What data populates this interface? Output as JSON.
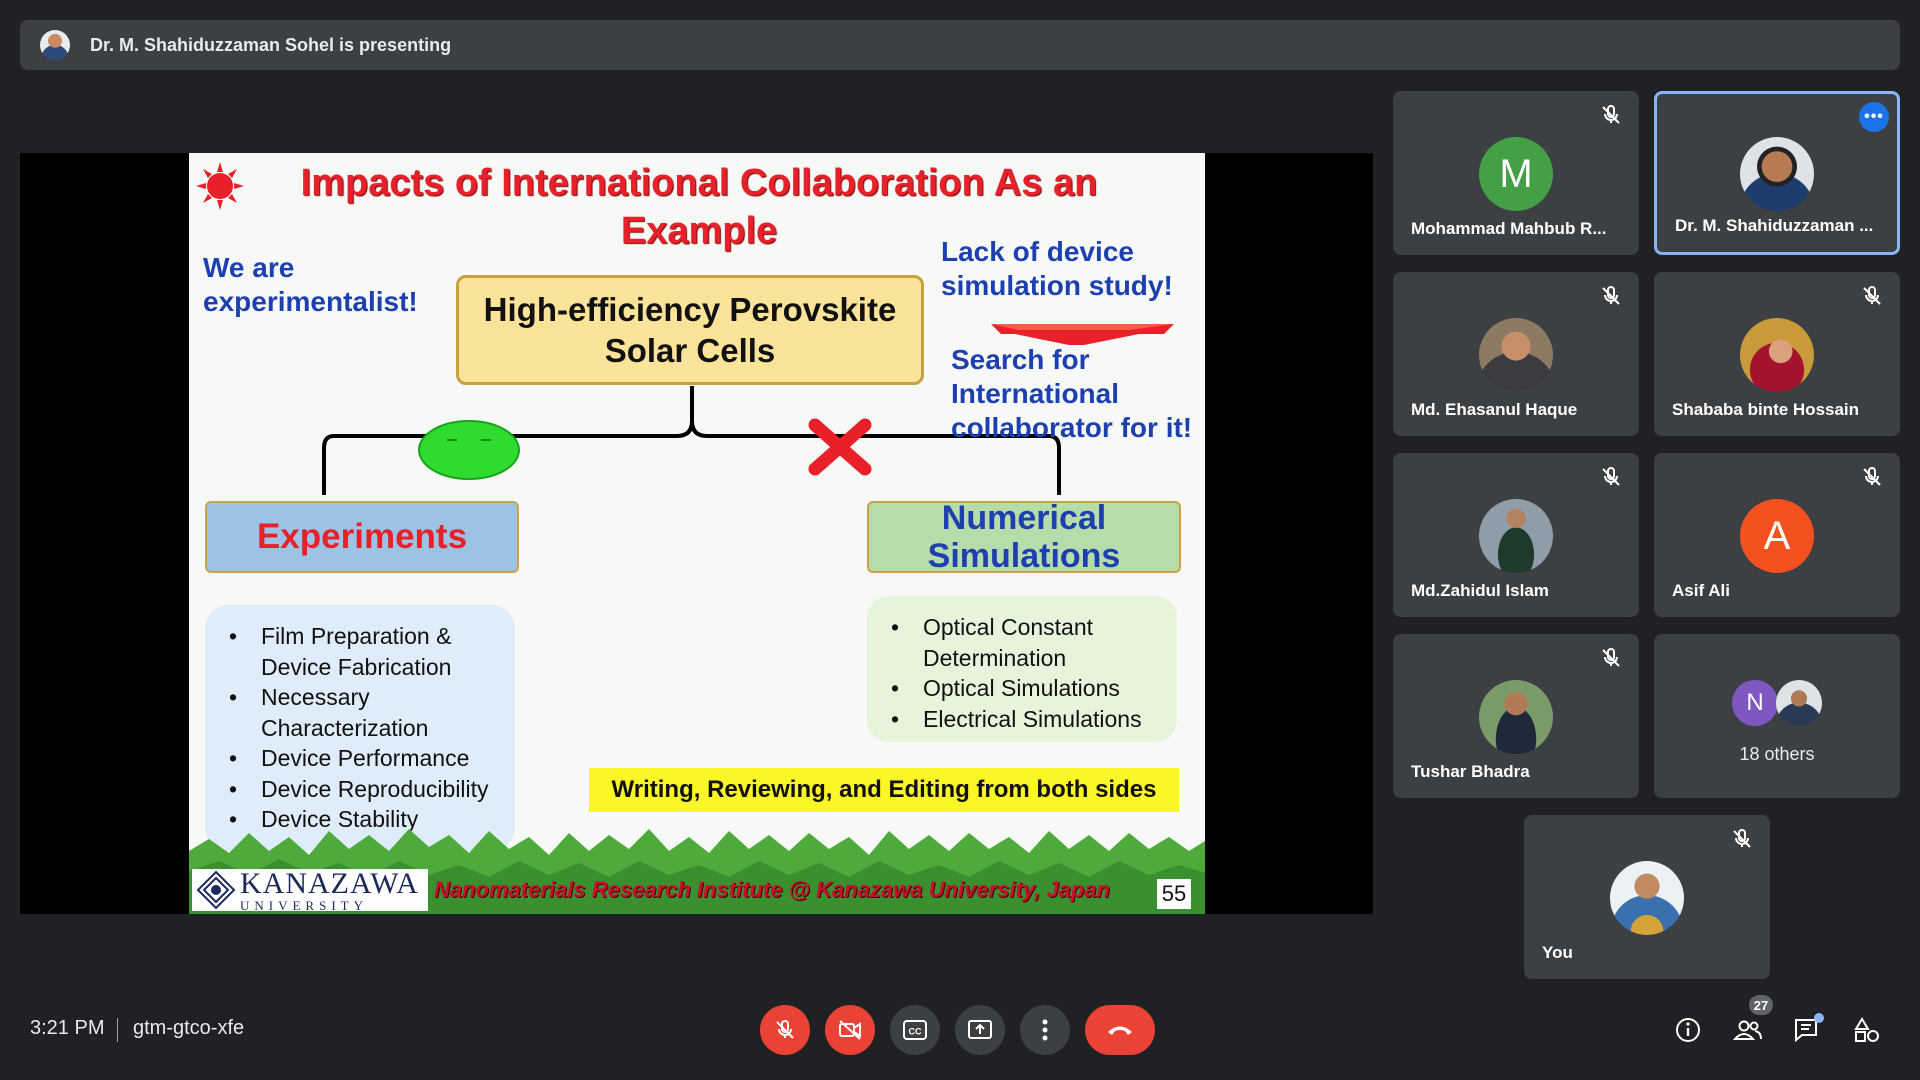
{
  "banner": {
    "text": "Dr. M. Shahiduzzaman Sohel is presenting"
  },
  "slide": {
    "title": "Impacts of International Collaboration As an Example",
    "experimentalist_note": "We are experimentalist!",
    "lack_note": "Lack of device simulation study!",
    "search_note": "Search for International collaborator for it!",
    "center_box": "High-efficiency Perovskite Solar Cells",
    "experiments_label": "Experiments",
    "numerical_label": "Numerical Simulations",
    "experiments_items": [
      "Film Preparation & Device Fabrication",
      "Necessary Characterization",
      "Device Performance",
      "Device Reproducibility",
      "Device Stability"
    ],
    "numerical_items": [
      "Optical Constant Determination",
      "Optical Simulations",
      "Electrical Simulations"
    ],
    "writing_note": "Writing, Reviewing, and Editing from both sides",
    "logo_main": "KANAZAWA",
    "logo_sub": "UNIVERSITY",
    "footer": "Nanomaterials Research Institute @ Kanazawa University, Japan",
    "page_number": "55"
  },
  "participants": [
    {
      "name": "Mohammad Mahbub R...",
      "initial": "M",
      "color": "#43a047",
      "muted": true
    },
    {
      "name": "Dr. M. Shahiduzzaman ...",
      "active": true,
      "muted": false
    },
    {
      "name": "Md. Ehasanul Haque",
      "muted": true
    },
    {
      "name": "Shababa binte Hossain",
      "muted": true
    },
    {
      "name": "Md.Zahidul Islam",
      "muted": true
    },
    {
      "name": "Asif Ali",
      "initial": "A",
      "color": "#f4511e",
      "muted": true
    },
    {
      "name": "Tushar Bhadra",
      "muted": true
    },
    {
      "others_label": "18 others",
      "initial": "N",
      "color": "#7e57c2"
    },
    {
      "name": "You",
      "muted": true
    }
  ],
  "bottom": {
    "time": "3:21 PM",
    "meeting_code": "gtm-gtco-xfe",
    "people_count": "27"
  },
  "colors": {
    "background": "#202124",
    "tile": "#3c4043",
    "red": "#ea4335",
    "accent": "#8ab4f8"
  }
}
